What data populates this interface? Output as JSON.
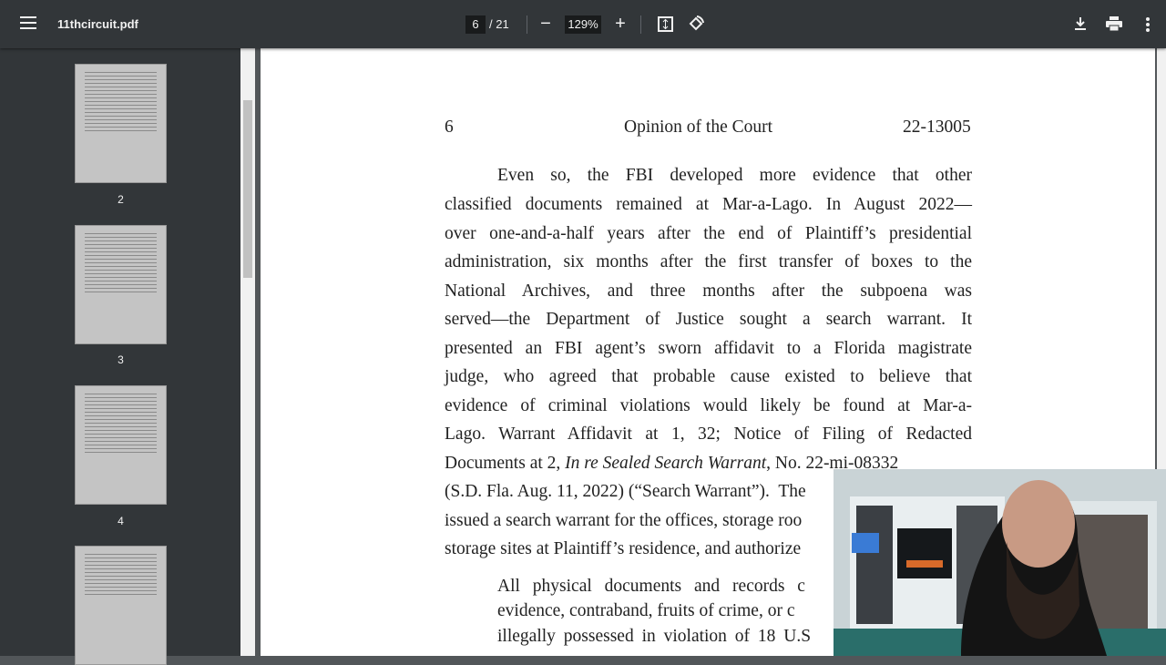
{
  "toolbar": {
    "filename": "11thcircuit.pdf",
    "current_page": "6",
    "total_pages": "/ 21",
    "zoom": "129%",
    "zoom_out": "−",
    "zoom_in": "+"
  },
  "sidebar": {
    "thumbnails": [
      {
        "label": "2"
      },
      {
        "label": "3"
      },
      {
        "label": "4"
      },
      {
        "label": ""
      }
    ]
  },
  "document": {
    "header_page": "6",
    "header_title": "Opinion of the Court",
    "header_case": "22-13005",
    "lines": [
      "Even so, the FBI developed more evidence that other",
      "classified documents remained at Mar-a-Lago.  In August 2022—",
      "over one-and-a-half years after the end of Plaintiff’s presidential",
      "administration, six months after the first transfer of boxes to the",
      "National Archives, and three months after the subpoena was",
      "served—the Department of Justice sought a search warrant.  It",
      "presented an FBI agent’s sworn affidavit to a Florida magistrate",
      "judge, who agreed that probable cause existed to believe that",
      "evidence of criminal violations would likely be found at Mar-a-",
      "Lago.  Warrant Affidavit at 1, 32; Notice of Filing of Redacted"
    ],
    "line11_a": "Documents at 2, ",
    "line11_italic": "In re Sealed Search Warrant",
    "line11_b": ", No. 22-mi-08332",
    "lines2": [
      "(S.D. Fla. Aug. 11, 2022) (“Search Warrant”).  The",
      "issued a search warrant for the offices, storage roo",
      "storage sites at Plaintiff’s residence, and authorize"
    ],
    "quote": [
      "All physical documents and records c",
      "evidence, contraband, fruits of crime, or c",
      "illegally possessed in violation of 18 U.S"
    ]
  }
}
